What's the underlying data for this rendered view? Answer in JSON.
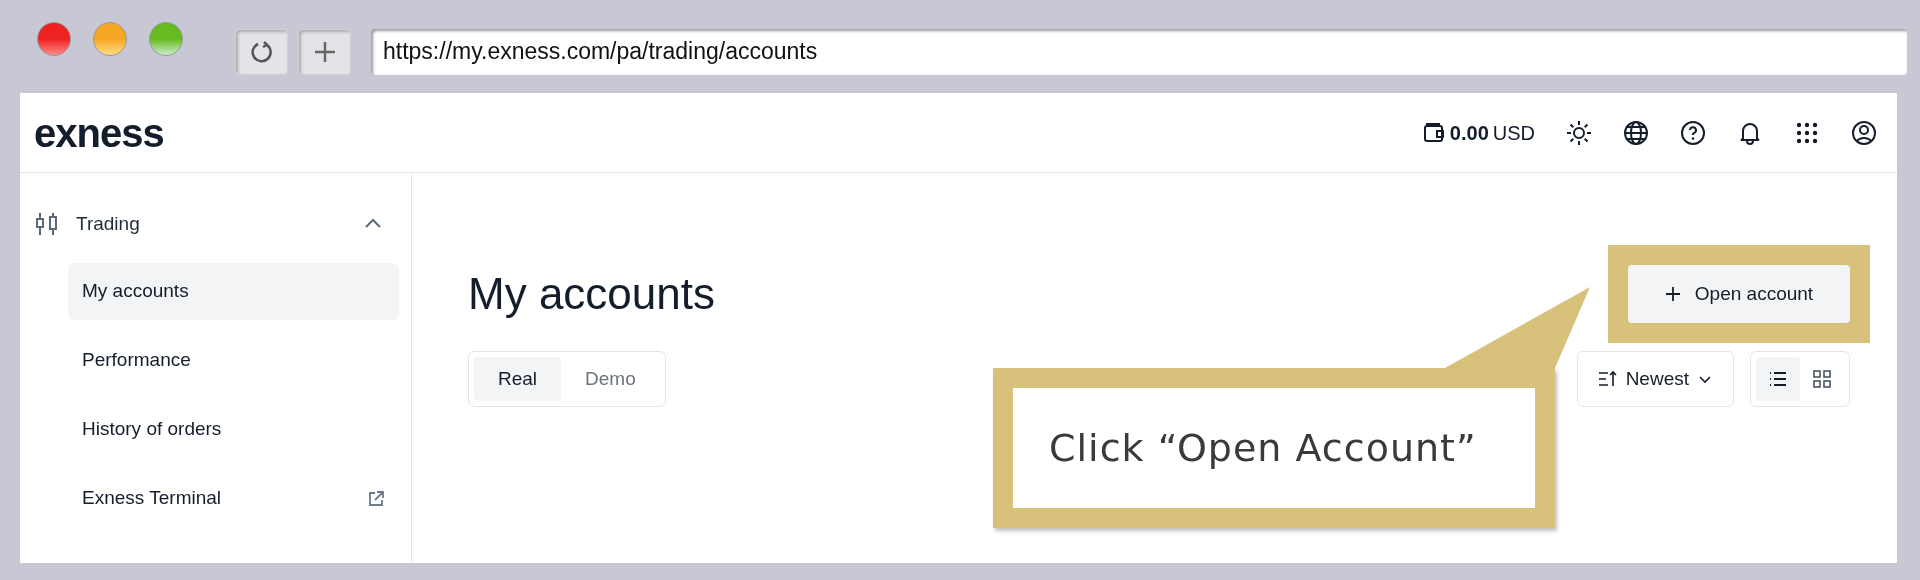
{
  "browser": {
    "url": "https://my.exness.com/pa/trading/accounts"
  },
  "header": {
    "logo": "exness",
    "balance_amount": "0.00",
    "balance_currency": "USD"
  },
  "sidebar": {
    "section": {
      "label": "Trading",
      "expanded": true
    },
    "items": [
      {
        "label": "My accounts",
        "selected": true,
        "external": false
      },
      {
        "label": "Performance",
        "selected": false,
        "external": false
      },
      {
        "label": "History of orders",
        "selected": false,
        "external": false
      },
      {
        "label": "Exness Terminal",
        "selected": false,
        "external": true
      }
    ]
  },
  "main": {
    "title": "My accounts",
    "open_button": "Open account",
    "tabs": [
      {
        "label": "Real",
        "selected": true
      },
      {
        "label": "Demo",
        "selected": false
      }
    ],
    "sort": {
      "label": "Newest"
    },
    "views": [
      {
        "kind": "list",
        "selected": true
      },
      {
        "kind": "grid",
        "selected": false
      }
    ]
  },
  "callout": {
    "text": "Click “Open Account”"
  }
}
